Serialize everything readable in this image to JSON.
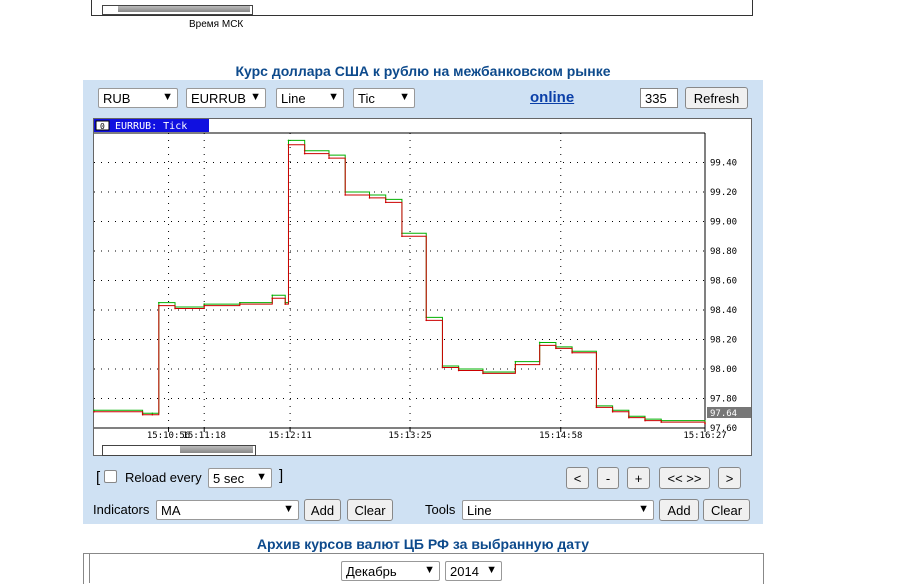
{
  "top": {
    "time_label": "Время МСК"
  },
  "main_title": "Курс доллара США к рублю на межбанковском рынке",
  "controls": {
    "currency": "RUB",
    "pair": "EURRUB",
    "chart_kind": "Line",
    "period": "Tic",
    "online_link": "online",
    "count_value": "335",
    "refresh_label": "Refresh"
  },
  "reload": {
    "open_bracket": "[",
    "label": "Reload every",
    "interval": "5 sec",
    "close_bracket": "]"
  },
  "nav": {
    "prev": "<",
    "zoom_out": "-",
    "zoom_in": "+",
    "full": "<< >>",
    "next": ">"
  },
  "indicators": {
    "label": "Indicators",
    "value": "MA",
    "add": "Add",
    "clear": "Clear"
  },
  "tools": {
    "label": "Tools",
    "value": "Line",
    "add": "Add",
    "clear": "Clear"
  },
  "archive": {
    "title": "Архив курсов валют ЦБ РФ за выбранную дату",
    "month": "Декабрь",
    "year": "2014"
  },
  "chart_data": {
    "type": "line",
    "title": "EURRUB: Tick",
    "series": [
      {
        "color": "#00b000",
        "x": [
          "15:10:10",
          "15:10:40",
          "15:10:46",
          "15:10:50",
          "15:11:00",
          "15:11:18",
          "15:11:40",
          "15:12:00",
          "15:12:08",
          "15:12:10",
          "15:12:20",
          "15:12:35",
          "15:12:45",
          "15:13:00",
          "15:13:10",
          "15:13:20",
          "15:13:35",
          "15:13:45",
          "15:13:55",
          "15:14:10",
          "15:14:30",
          "15:14:45",
          "15:14:55",
          "15:15:05",
          "15:15:20",
          "15:15:30",
          "15:15:40",
          "15:15:50",
          "15:16:00",
          "15:16:27"
        ],
        "values": [
          97.72,
          97.7,
          97.7,
          98.45,
          98.42,
          98.44,
          98.45,
          98.5,
          98.45,
          99.55,
          99.48,
          99.45,
          99.2,
          99.18,
          99.15,
          98.92,
          98.35,
          98.02,
          98.0,
          97.98,
          98.05,
          98.18,
          98.15,
          98.12,
          97.75,
          97.72,
          97.68,
          97.66,
          97.65,
          97.64
        ]
      },
      {
        "color": "#cc0000",
        "x": [
          "15:10:10",
          "15:10:40",
          "15:10:46",
          "15:10:50",
          "15:11:00",
          "15:11:18",
          "15:11:40",
          "15:12:00",
          "15:12:08",
          "15:12:10",
          "15:12:20",
          "15:12:35",
          "15:12:45",
          "15:13:00",
          "15:13:10",
          "15:13:20",
          "15:13:35",
          "15:13:45",
          "15:13:55",
          "15:14:10",
          "15:14:30",
          "15:14:45",
          "15:14:55",
          "15:15:05",
          "15:15:20",
          "15:15:30",
          "15:15:40",
          "15:15:50",
          "15:16:00",
          "15:16:27"
        ],
        "values": [
          97.71,
          97.69,
          97.69,
          98.43,
          98.41,
          98.43,
          98.44,
          98.48,
          98.44,
          99.52,
          99.46,
          99.43,
          99.18,
          99.16,
          99.13,
          98.9,
          98.33,
          98.01,
          97.99,
          97.97,
          98.03,
          98.16,
          98.14,
          98.11,
          97.74,
          97.71,
          97.67,
          97.65,
          97.64,
          97.63
        ]
      }
    ],
    "ylim": [
      97.6,
      99.6
    ],
    "y_ticks": [
      "99.40",
      "99.20",
      "99.00",
      "98.80",
      "98.60",
      "98.40",
      "98.20",
      "98.00",
      "97.80",
      "97.60"
    ],
    "x_ticks": [
      "15:10:56",
      "15:11:18",
      "15:12:11",
      "15:13:25",
      "15:14:58",
      "15:16:27"
    ],
    "last_value_label": "97.64",
    "grid": true
  }
}
